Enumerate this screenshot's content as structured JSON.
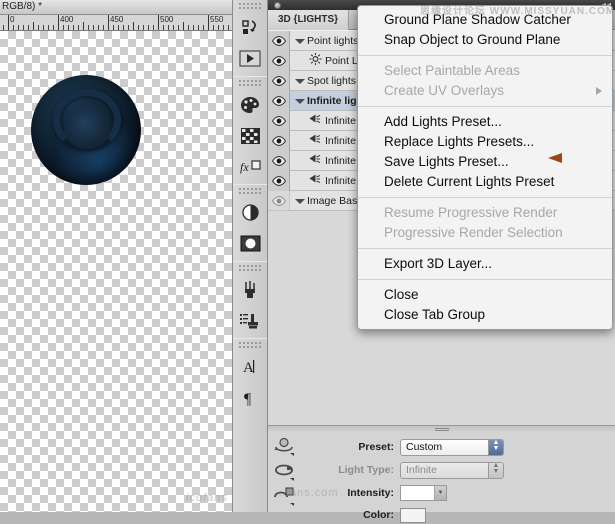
{
  "document": {
    "title": "RGB/8) *",
    "ruler": {
      "unit_labels": [
        "400",
        "450",
        "500",
        "550"
      ],
      "origin_label": "0"
    },
    "object_name": "3d-sphere-render"
  },
  "toolbar": {
    "tools": [
      {
        "name": "path-selection-tool",
        "glyph": "tool-path"
      },
      {
        "name": "play-render-tool",
        "glyph": "tool-play"
      },
      {
        "name": "palette-tool",
        "glyph": "tool-palette"
      },
      {
        "name": "swatches-grid-tool",
        "glyph": "tool-grid"
      },
      {
        "name": "fx-layer-style-tool",
        "glyph": "tool-fx"
      },
      {
        "name": "gradient-circle-tool",
        "glyph": "tool-halfcircle"
      },
      {
        "name": "mask-tool",
        "glyph": "tool-mask"
      },
      {
        "name": "brush-tool",
        "glyph": "tool-brush"
      },
      {
        "name": "clone-stamp-tool",
        "glyph": "tool-stamp"
      },
      {
        "name": "type-tool",
        "glyph": "tool-type"
      },
      {
        "name": "paragraph-tool",
        "glyph": "tool-paragraph"
      }
    ]
  },
  "panel": {
    "tab_label": "3D {LIGHTS}",
    "rows": [
      {
        "label": "Point lights",
        "type": "group",
        "expanded": true,
        "visible": true,
        "selected": false,
        "indent": false,
        "glyph": ""
      },
      {
        "label": "Point Li",
        "type": "light",
        "expanded": false,
        "visible": true,
        "selected": false,
        "indent": true,
        "glyph": "point-light-icon"
      },
      {
        "label": "Spot lights",
        "type": "group",
        "expanded": true,
        "visible": true,
        "selected": false,
        "indent": false,
        "glyph": ""
      },
      {
        "label": "Infinite ligh",
        "type": "group",
        "expanded": true,
        "visible": true,
        "selected": true,
        "indent": false,
        "glyph": ""
      },
      {
        "label": "Infinite",
        "type": "light",
        "expanded": false,
        "visible": true,
        "selected": false,
        "indent": true,
        "glyph": "infinite-light-icon"
      },
      {
        "label": "Infinite",
        "type": "light",
        "expanded": false,
        "visible": true,
        "selected": false,
        "indent": true,
        "glyph": "infinite-light-icon"
      },
      {
        "label": "Infinite",
        "type": "light",
        "expanded": false,
        "visible": true,
        "selected": false,
        "indent": true,
        "glyph": "infinite-light-icon"
      },
      {
        "label": "Infinite",
        "type": "light",
        "expanded": false,
        "visible": true,
        "selected": false,
        "indent": true,
        "glyph": "infinite-light-icon"
      },
      {
        "label": "Image Based",
        "type": "group",
        "expanded": true,
        "visible": false,
        "selected": false,
        "indent": false,
        "glyph": ""
      }
    ]
  },
  "properties": {
    "preset": {
      "label": "Preset:",
      "value": "Custom",
      "enabled": true
    },
    "light_type": {
      "label": "Light Type:",
      "value": "Infinite",
      "enabled": false
    },
    "intensity": {
      "label": "Intensity:",
      "value": "",
      "enabled": true
    },
    "color": {
      "label": "Color:",
      "value": "#f4f4f4"
    },
    "tools": [
      {
        "name": "rotate-light-tool"
      },
      {
        "name": "drag-light-tool"
      },
      {
        "name": "slide-light-tool"
      }
    ]
  },
  "context_menu": {
    "items": [
      {
        "label": "Ground Plane Shadow Catcher",
        "disabled": false,
        "submenu": false,
        "separator_after": false
      },
      {
        "label": "Snap Object to Ground Plane",
        "disabled": false,
        "submenu": false,
        "separator_after": true
      },
      {
        "label": "Select Paintable Areas",
        "disabled": true,
        "submenu": false,
        "separator_after": false
      },
      {
        "label": "Create UV Overlays",
        "disabled": true,
        "submenu": true,
        "separator_after": true
      },
      {
        "label": "Add Lights Preset...",
        "disabled": false,
        "submenu": false,
        "separator_after": false
      },
      {
        "label": "Replace Lights Presets...",
        "disabled": false,
        "submenu": false,
        "separator_after": false
      },
      {
        "label": "Save Lights Preset...",
        "disabled": false,
        "submenu": false,
        "separator_after": false
      },
      {
        "label": "Delete Current Lights Preset",
        "disabled": false,
        "submenu": false,
        "separator_after": true
      },
      {
        "label": "Resume Progressive Render",
        "disabled": true,
        "submenu": false,
        "separator_after": false
      },
      {
        "label": "Progressive Render Selection",
        "disabled": true,
        "submenu": false,
        "separator_after": true
      },
      {
        "label": "Export 3D Layer...",
        "disabled": false,
        "submenu": false,
        "separator_after": true
      },
      {
        "label": "Close",
        "disabled": false,
        "submenu": false,
        "separator_after": false
      },
      {
        "label": "Close Tab Group",
        "disabled": false,
        "submenu": false,
        "separator_after": false
      }
    ],
    "highlight_arrow_color": "#9c4413",
    "highlight_target": "Replace Lights Presets..."
  },
  "watermarks": {
    "top": "思缘设计论坛  WWW.MISSYUAN.COM",
    "mid": "…ans.com",
    "bottom": "icofans"
  }
}
